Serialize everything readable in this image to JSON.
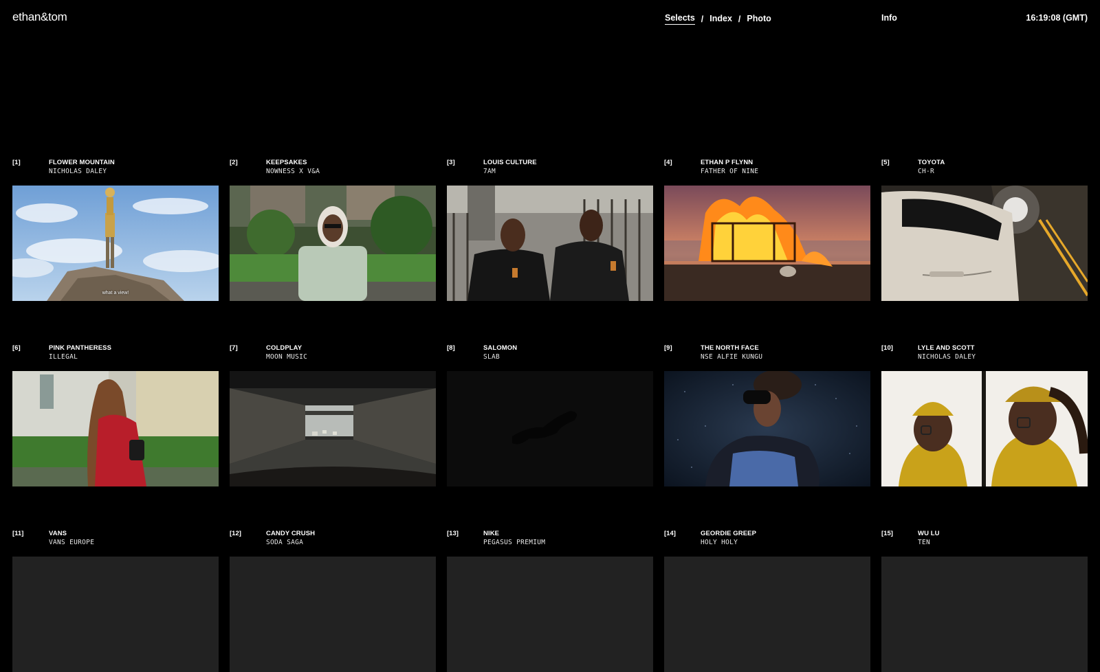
{
  "header": {
    "logo": "ethan&tom",
    "nav": [
      {
        "label": "Selects",
        "active": true
      },
      {
        "label": "Index",
        "active": false
      },
      {
        "label": "Photo",
        "active": false
      }
    ],
    "nav_separator": "/",
    "info": "Info",
    "clock": "16:19:08 (GMT)"
  },
  "projects": [
    {
      "num": "[1]",
      "title": "FLOWER MOUNTAIN",
      "subtitle": "NICHOLAS DALEY",
      "thumb_caption": "what a view!"
    },
    {
      "num": "[2]",
      "title": "KEEPSAKES",
      "subtitle": "NOWNESS X V&A"
    },
    {
      "num": "[3]",
      "title": "LOUIS CULTURE",
      "subtitle": "7AM"
    },
    {
      "num": "[4]",
      "title": "ETHAN P FLYNN",
      "subtitle": "FATHER OF NINE"
    },
    {
      "num": "[5]",
      "title": "TOYOTA",
      "subtitle": "CH-R"
    },
    {
      "num": "[6]",
      "title": "PINK PANTHERESS",
      "subtitle": "ILLEGAL"
    },
    {
      "num": "[7]",
      "title": "COLDPLAY",
      "subtitle": "MOON MUSIC"
    },
    {
      "num": "[8]",
      "title": "SALOMON",
      "subtitle": "SLAB"
    },
    {
      "num": "[9]",
      "title": "THE NORTH FACE",
      "subtitle": "NSE ALFIE KUNGU"
    },
    {
      "num": "[10]",
      "title": "LYLE AND SCOTT",
      "subtitle": "NICHOLAS DALEY"
    },
    {
      "num": "[11]",
      "title": "VANS",
      "subtitle": "VANS EUROPE"
    },
    {
      "num": "[12]",
      "title": "CANDY CRUSH",
      "subtitle": "SODA SAGA"
    },
    {
      "num": "[13]",
      "title": "NIKE",
      "subtitle": "PEGASUS PREMIUM"
    },
    {
      "num": "[14]",
      "title": "GEORDIE GREEP",
      "subtitle": "HOLY HOLY"
    },
    {
      "num": "[15]",
      "title": "WU LU",
      "subtitle": "TEN"
    }
  ],
  "colors": {
    "background": "#000000",
    "text": "#ffffff"
  }
}
